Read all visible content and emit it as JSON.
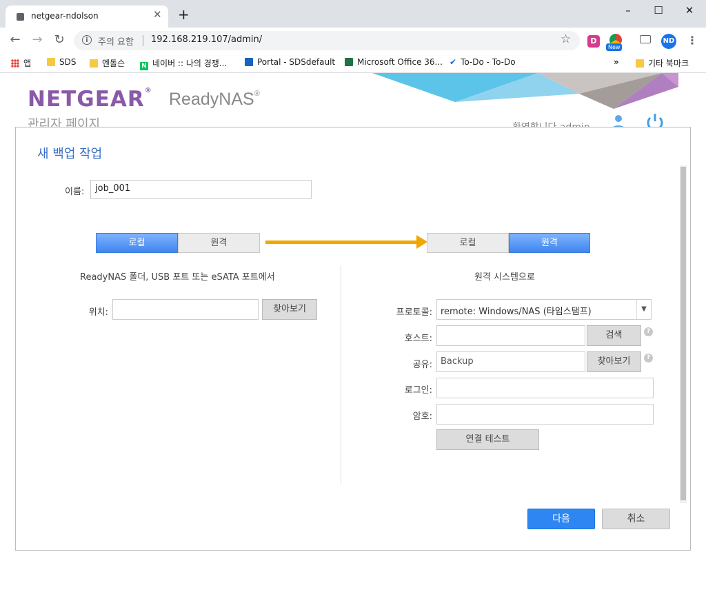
{
  "browser": {
    "tab_title": "netgear-ndolson",
    "security_label": "주의 요함",
    "url": "192.168.219.107/admin/",
    "profile_initials": "ND",
    "extension_d_label": "D",
    "extension_new_badge": "New",
    "window_controls": [
      "–",
      "☐",
      "✕"
    ],
    "bookmarks": [
      {
        "label": "앱",
        "icon": "apps-grid-icon"
      },
      {
        "label": "SDS",
        "icon": "folder-icon"
      },
      {
        "label": "엔돌슨",
        "icon": "folder-icon"
      },
      {
        "label": "네이버 :: 나의 경쟁...",
        "icon": "naver-icon"
      },
      {
        "label": "Portal - SDSdefault",
        "icon": "portal-icon"
      },
      {
        "label": "Microsoft Office 36...",
        "icon": "office-icon"
      },
      {
        "label": "To-Do - To-Do",
        "icon": "todo-check-icon"
      }
    ],
    "bookmarks_overflow": "»",
    "other_bookmarks": "기타 북마크"
  },
  "header": {
    "brand": "NETGEAR",
    "brand_mark": "®",
    "product": "ReadyNAS",
    "product_mark": "®",
    "admin_page": "관리자 페이지",
    "welcome": "환영합니다 admin"
  },
  "dialog": {
    "title": "새 백업 작업",
    "name_label": "이름:",
    "name_value": "job_001",
    "source": {
      "toggle": [
        "로컬",
        "원격"
      ],
      "selected": "로컬",
      "title": "ReadyNAS 폴더, USB 포트 또는 eSATA 포트에서",
      "location_label": "위치:",
      "location_value": "",
      "browse_label": "찾아보기"
    },
    "destination": {
      "toggle": [
        "로컬",
        "원격"
      ],
      "selected": "원격",
      "title": "원격 시스템으로",
      "protocol_label": "프로토콜:",
      "protocol_value": "remote: Windows/NAS (타임스탬프)",
      "host_label": "호스트:",
      "host_value": "",
      "search_label": "검색",
      "share_label": "공유:",
      "share_value": "Backup",
      "browse_label": "찾아보기",
      "login_label": "로그인:",
      "login_value": "",
      "password_label": "암호:",
      "password_value": "",
      "test_label": "연결 테스트",
      "help_glyph": "?"
    },
    "next_label": "다음",
    "cancel_label": "취소"
  },
  "colors": {
    "brand_purple": "#8a59a8",
    "title_blue": "#3a6fc4",
    "primary_button": "#2d86f2",
    "arrow": "#f0a800",
    "toggle_active": "#5b9af5"
  }
}
